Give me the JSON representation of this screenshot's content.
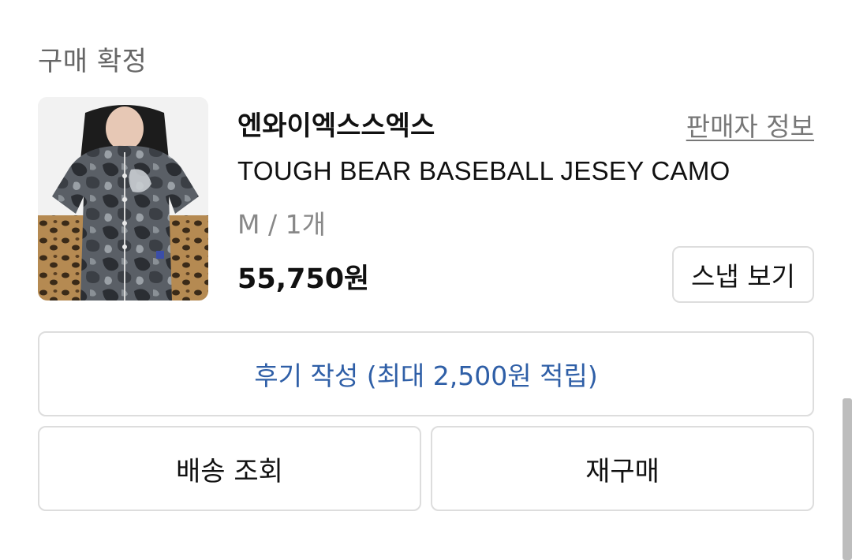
{
  "section": {
    "title": "구매 확정"
  },
  "order": {
    "seller_name": "엔와이엑스스엑스",
    "seller_info_link": "판매자 정보",
    "product_name": "TOUGH BEAR BASEBALL JESEY CAMO",
    "option": "M / 1개",
    "price": "55,750원",
    "snap_button": "스냅 보기"
  },
  "actions": {
    "review_button": "후기 작성 (최대 2,500원 적립)",
    "shipping_button": "배송 조회",
    "rebuy_button": "재구매"
  },
  "colors": {
    "accent": "#2f5fa7",
    "border": "#dddddd",
    "muted_text": "#888888"
  }
}
